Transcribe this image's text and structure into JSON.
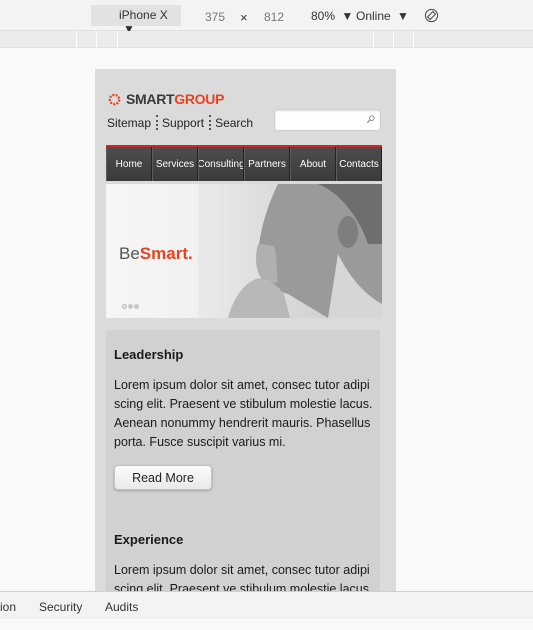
{
  "device_toolbar": {
    "device": "iPhone X",
    "width": "375",
    "times": "×",
    "height": "812",
    "zoom": "80%",
    "network": "Online",
    "dropdown_arrow": "▼",
    "rotate_icon": "rotate-icon"
  },
  "site": {
    "logo": {
      "part1": "SMART",
      "part2": "GROUP"
    },
    "toplinks": [
      "Sitemap",
      "Support",
      "Search"
    ],
    "search": {
      "placeholder": "",
      "value": ""
    },
    "nav": [
      "Home",
      "Services",
      "Consulting",
      "Partners",
      "About",
      "Contacts"
    ],
    "hero": {
      "be": "Be",
      "smart": "Smart."
    },
    "sections": [
      {
        "title": "Leadership",
        "body": "Lorem ipsum dolor sit amet, consec tutor adipi scing elit. Praesent ve stibulum molestie lacus. Aenean nonummy hendrerit mauris. Phasellus porta. Fusce suscipit varius mi.",
        "button": "Read More"
      },
      {
        "title": "Experience",
        "body": "Lorem ipsum dolor sit amet, consec tutor adipi scing elit. Praesent ve stibulum molestie lacus."
      }
    ]
  },
  "devtools_tabs": [
    "ion",
    "Security",
    "Audits"
  ],
  "colors": {
    "accent": "#e8451f",
    "nav_border": "#d4232a",
    "nav_bg": "#444444"
  }
}
